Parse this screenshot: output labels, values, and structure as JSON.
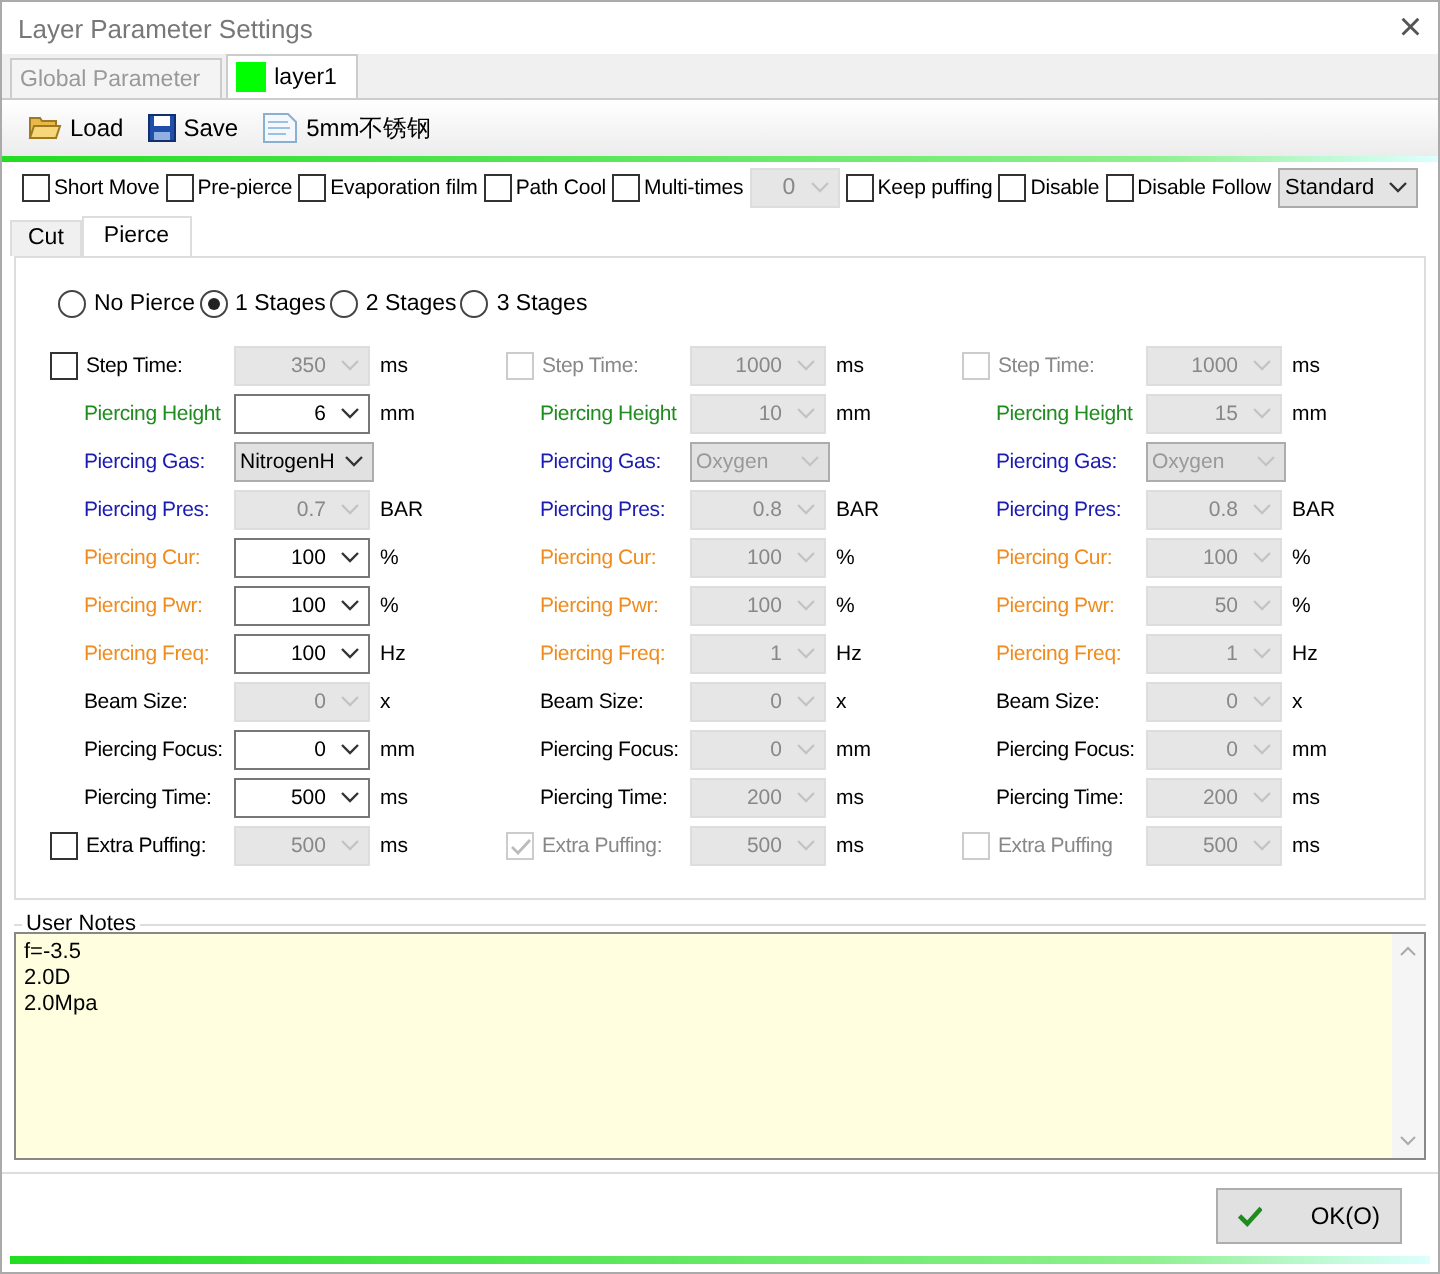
{
  "window": {
    "title": "Layer Parameter Settings",
    "close": "×"
  },
  "layer_tabs": [
    {
      "label": "Global Parameter",
      "selected": false
    },
    {
      "label": "layer1",
      "selected": true,
      "color": "#00ff00"
    }
  ],
  "toolbar": [
    {
      "kind": "load",
      "label": "Load"
    },
    {
      "kind": "save",
      "label": "Save"
    },
    {
      "kind": "file",
      "label": "5mm不锈钢"
    }
  ],
  "options": [
    {
      "kind": "check",
      "label": "Short Move",
      "checked": false
    },
    {
      "kind": "check",
      "label": "Pre-pierce",
      "checked": false
    },
    {
      "kind": "check",
      "label": "Evaporation film",
      "checked": false
    },
    {
      "kind": "check",
      "label": "Path Cool",
      "checked": false
    },
    {
      "kind": "check",
      "label": "Multi-times",
      "checked": false
    },
    {
      "kind": "dropdown",
      "value": "0",
      "disabled": true
    },
    {
      "kind": "check",
      "label": "Keep puffing",
      "checked": false
    },
    {
      "kind": "check",
      "label": "Disable",
      "checked": false
    },
    {
      "kind": "check",
      "label": "Disable Follow",
      "checked": false
    },
    {
      "kind": "dropdown",
      "value": "Standard",
      "disabled": false
    }
  ],
  "sub_tabs": [
    {
      "label": "Cut",
      "selected": false
    },
    {
      "label": "Pierce",
      "selected": true
    }
  ],
  "pierce_modes": [
    {
      "label": "No Pierce",
      "selected": false
    },
    {
      "label": "1 Stages",
      "selected": true
    },
    {
      "label": "2 Stages",
      "selected": false
    },
    {
      "label": "3 Stages",
      "selected": false
    }
  ],
  "stages": [
    {
      "rows": [
        {
          "kind": "check",
          "label": "Step Time:",
          "checked": false,
          "check_disabled": false,
          "value": "350",
          "unit": "ms",
          "disabled": true
        },
        {
          "kind": "plain",
          "label": "Piercing Height",
          "color": "#1e8c1e",
          "value": "6",
          "unit": "mm",
          "disabled": false
        },
        {
          "kind": "combo",
          "label": "Piercing Gas:",
          "color": "#1a1ab4",
          "value": "NitrogenH",
          "disabled": false
        },
        {
          "kind": "plain",
          "label": "Piercing Pres:",
          "color": "#1a1ab4",
          "value": "0.7",
          "unit": "BAR",
          "disabled": true
        },
        {
          "kind": "plain",
          "label": "Piercing Cur:",
          "color": "#f08c1e",
          "value": "100",
          "unit": "%",
          "disabled": false
        },
        {
          "kind": "plain",
          "label": "Piercing Pwr:",
          "color": "#f08c1e",
          "value": "100",
          "unit": "%",
          "disabled": false
        },
        {
          "kind": "plain",
          "label": "Piercing Freq:",
          "color": "#f08c1e",
          "value": "100",
          "unit": "Hz",
          "disabled": false
        },
        {
          "kind": "plain",
          "label": "Beam Size:",
          "color": "#000000",
          "value": "0",
          "unit": "x",
          "disabled": true
        },
        {
          "kind": "plain",
          "label": "Piercing Focus:",
          "color": "#000000",
          "value": "0",
          "unit": "mm",
          "disabled": false
        },
        {
          "kind": "plain",
          "label": "Piercing Time:",
          "color": "#000000",
          "value": "500",
          "unit": "ms",
          "disabled": false
        },
        {
          "kind": "check",
          "label": "Extra Puffing:",
          "checked": false,
          "check_disabled": false,
          "value": "500",
          "unit": "ms",
          "disabled": true
        }
      ]
    },
    {
      "rows": [
        {
          "kind": "check",
          "label": "Step Time:",
          "checked": false,
          "check_disabled": true,
          "value": "1000",
          "unit": "ms",
          "disabled": true
        },
        {
          "kind": "plain",
          "label": "Piercing Height",
          "color": "#1e8c1e",
          "value": "10",
          "unit": "mm",
          "disabled": true
        },
        {
          "kind": "combo",
          "label": "Piercing Gas:",
          "color": "#1a1ab4",
          "value": "Oxygen",
          "disabled": true
        },
        {
          "kind": "plain",
          "label": "Piercing Pres:",
          "color": "#1a1ab4",
          "value": "0.8",
          "unit": "BAR",
          "disabled": true
        },
        {
          "kind": "plain",
          "label": "Piercing Cur:",
          "color": "#f08c1e",
          "value": "100",
          "unit": "%",
          "disabled": true
        },
        {
          "kind": "plain",
          "label": "Piercing Pwr:",
          "color": "#f08c1e",
          "value": "100",
          "unit": "%",
          "disabled": true
        },
        {
          "kind": "plain",
          "label": "Piercing Freq:",
          "color": "#f08c1e",
          "value": "1",
          "unit": "Hz",
          "disabled": true
        },
        {
          "kind": "plain",
          "label": "Beam Size:",
          "color": "#000000",
          "value": "0",
          "unit": "x",
          "disabled": true
        },
        {
          "kind": "plain",
          "label": "Piercing Focus:",
          "color": "#000000",
          "value": "0",
          "unit": "mm",
          "disabled": true
        },
        {
          "kind": "plain",
          "label": "Piercing Time:",
          "color": "#000000",
          "value": "200",
          "unit": "ms",
          "disabled": true
        },
        {
          "kind": "check",
          "label": "Extra Puffing:",
          "checked": true,
          "check_disabled": true,
          "value": "500",
          "unit": "ms",
          "disabled": true
        }
      ]
    },
    {
      "rows": [
        {
          "kind": "check",
          "label": "Step Time:",
          "checked": false,
          "check_disabled": true,
          "value": "1000",
          "unit": "ms",
          "disabled": true
        },
        {
          "kind": "plain",
          "label": "Piercing Height",
          "color": "#1e8c1e",
          "value": "15",
          "unit": "mm",
          "disabled": true
        },
        {
          "kind": "combo",
          "label": "Piercing Gas:",
          "color": "#1a1ab4",
          "value": "Oxygen",
          "disabled": true
        },
        {
          "kind": "plain",
          "label": "Piercing Pres:",
          "color": "#1a1ab4",
          "value": "0.8",
          "unit": "BAR",
          "disabled": true
        },
        {
          "kind": "plain",
          "label": "Piercing Cur:",
          "color": "#f08c1e",
          "value": "100",
          "unit": "%",
          "disabled": true
        },
        {
          "kind": "plain",
          "label": "Piercing Pwr:",
          "color": "#f08c1e",
          "value": "50",
          "unit": "%",
          "disabled": true
        },
        {
          "kind": "plain",
          "label": "Piercing Freq:",
          "color": "#f08c1e",
          "value": "1",
          "unit": "Hz",
          "disabled": true
        },
        {
          "kind": "plain",
          "label": "Beam Size:",
          "color": "#000000",
          "value": "0",
          "unit": "x",
          "disabled": true
        },
        {
          "kind": "plain",
          "label": "Piercing Focus:",
          "color": "#000000",
          "value": "0",
          "unit": "mm",
          "disabled": true
        },
        {
          "kind": "plain",
          "label": "Piercing Time:",
          "color": "#000000",
          "value": "200",
          "unit": "ms",
          "disabled": true
        },
        {
          "kind": "check",
          "label": "Extra Puffing",
          "checked": false,
          "check_disabled": true,
          "value": "500",
          "unit": "ms",
          "disabled": true
        }
      ]
    }
  ],
  "notes": {
    "label": "User Notes",
    "value": "f=-3.5\n2.0D\n2.0Mpa"
  },
  "ok_button": {
    "label": "OK(O)"
  }
}
